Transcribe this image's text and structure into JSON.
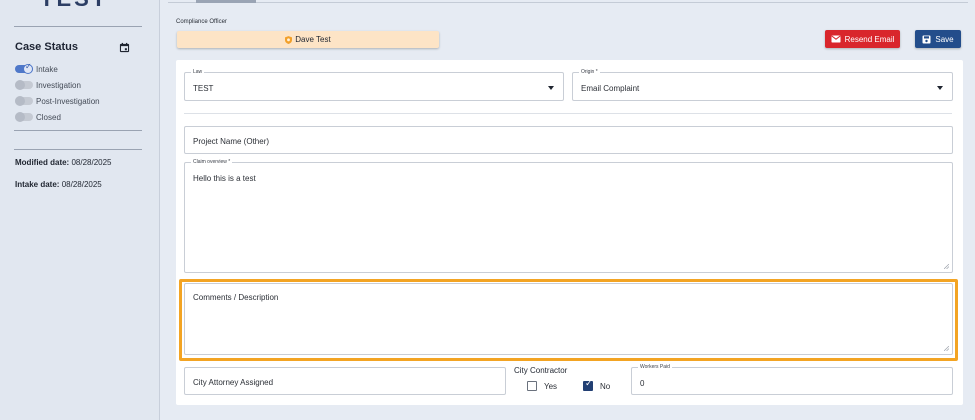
{
  "sidebar": {
    "logo_fragment": "TEST",
    "case_status_title": "Case Status",
    "statuses": [
      {
        "label": "Intake",
        "on": true
      },
      {
        "label": "Investigation",
        "on": false
      },
      {
        "label": "Post-Investigation",
        "on": false
      },
      {
        "label": "Closed",
        "on": false
      }
    ],
    "modified_label": "Modified date:",
    "modified_value": "08/28/2025",
    "intake_label": "Intake date:",
    "intake_value": "08/28/2025"
  },
  "header": {
    "compliance_officer_label": "Compliance Officer",
    "compliance_officer_name": "Dave Test",
    "resend_email_label": "Resend Email",
    "save_label": "Save"
  },
  "form": {
    "law_label": "Law",
    "law_value": "TEST",
    "origin_label": "Origin *",
    "origin_value": "Email Complaint",
    "project_name_placeholder": "Project Name (Other)",
    "claim_overview_label": "Claim overview *",
    "claim_overview_value": "Hello this is a test",
    "comments_placeholder": "Comments / Description",
    "city_attorney_placeholder": "City Attorney Assigned",
    "city_contractor_label": "City Contractor",
    "yes_label": "Yes",
    "no_label": "No",
    "city_contractor_value": "No",
    "workers_paid_label": "Workers Paid",
    "workers_paid_value": "0"
  },
  "colors": {
    "resend": "#d9262c",
    "save": "#234d8b",
    "highlight": "#f3a423",
    "officer_bg": "#fde4c6",
    "toggle_on": "#4f78c9"
  }
}
